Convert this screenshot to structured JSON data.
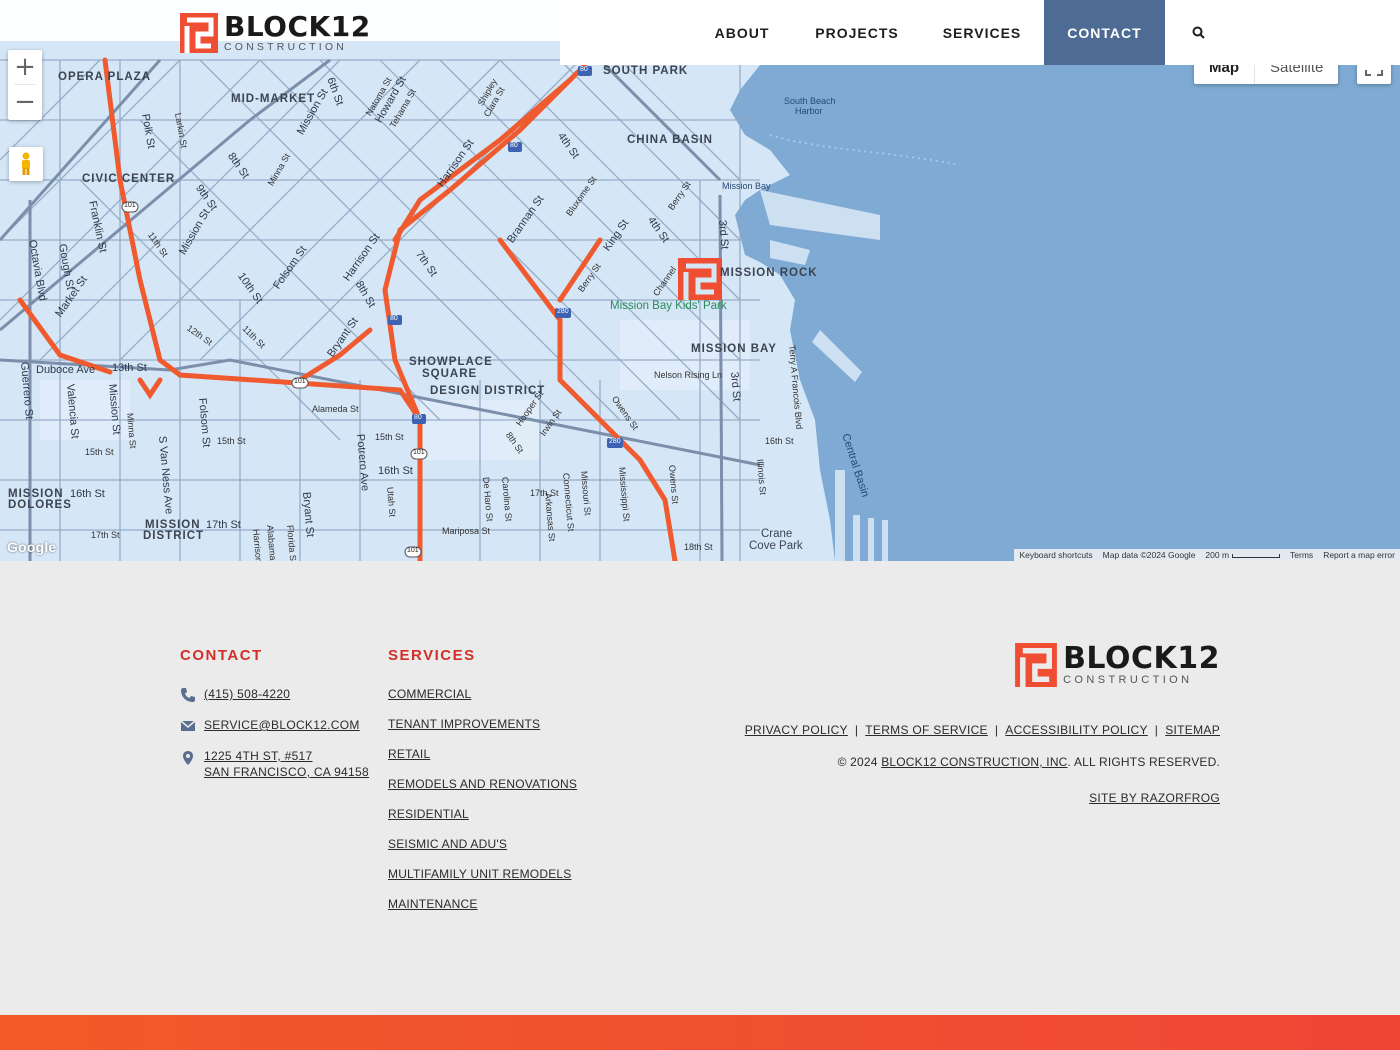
{
  "brand": {
    "name": "BLOCK12",
    "sub": "CONSTRUCTION",
    "accent": "#f04e30",
    "nav_active_bg": "#4e6b93"
  },
  "nav": {
    "about": "ABOUT",
    "projects": "PROJECTS",
    "services": "SERVICES",
    "contact": "CONTACT",
    "search_icon": "search-icon"
  },
  "map": {
    "type_map": "Map",
    "type_satellite": "Satellite",
    "zoom_in": "+",
    "zoom_out": "−",
    "google": "Google",
    "attribution": {
      "shortcuts": "Keyboard shortcuts",
      "data": "Map data ©2024 Google",
      "scale": "200 m",
      "terms": "Terms",
      "report": "Report a map error"
    },
    "districts": [
      "OPERA PLAZA",
      "MID-MARKET",
      "SOUTH PARK",
      "CHINA BASIN",
      "CIVIC CENTER",
      "MISSION ROCK",
      "MISSION BAY",
      "SHOWPLACE",
      "SQUARE",
      "DESIGN DISTRICT",
      "MISSION",
      "DOLORES",
      "MISSION",
      "DISTRICT"
    ],
    "park": "Mission Bay Kids' Park",
    "water": [
      "South Beach",
      "Harbor",
      "Mission Bay",
      "Central Basin",
      "Crane",
      "Cove Park"
    ],
    "streets": [
      "6th St",
      "Mission St",
      "Natoma St",
      "Howard St",
      "Tehama St",
      "Shipley",
      "Clara St",
      "4th St",
      "Polk St",
      "Larkin St",
      "8th St",
      "Minna St",
      "9th St",
      "Franklin St",
      "11th St",
      "Mission St",
      "Harrison St",
      "Brannan St",
      "Bluxome St",
      "Berry St",
      "King St",
      "4th St",
      "3rd St",
      "Channel",
      "Octavia Blvd",
      "Gough St",
      "Market St",
      "10th St",
      "Folsom St",
      "Harrison St",
      "7th St",
      "8th St",
      "Berry St",
      "Duboce Ave",
      "13th St",
      "12th St",
      "11th St",
      "Bryant St",
      "Alameda St",
      "Nelson Rising Ln",
      "Terry A Francois Blvd",
      "Guerrero St",
      "Valencia St",
      "Mission St",
      "Minna St",
      "Folsom St",
      "15th St",
      "15th St",
      "15th St",
      "Potrero Ave",
      "16th St",
      "16th St",
      "Hooper St",
      "Irwin St",
      "8th St",
      "Owens St",
      "3rd St",
      "16th St",
      "Illinois St",
      "17th St",
      "17th St",
      "17th St",
      "S Van Ness Ave",
      "Bryant St",
      "Utah St",
      "De Haro St",
      "Carolina St",
      "Arkansas St",
      "Connecticut St",
      "Missouri St",
      "Mississippi St",
      "Owens St",
      "Mariposa St",
      "18th St",
      "Alabama St",
      "Florida St",
      "Harrison"
    ],
    "shields": [
      "80",
      "80",
      "101",
      "80",
      "280",
      "101",
      "80",
      "101",
      "280",
      "101"
    ]
  },
  "footer": {
    "contact_title": "CONTACT",
    "phone": "(415) 508-4220",
    "email": "SERVICE@BLOCK12.COM",
    "address_line1": "1225 4TH ST, #517",
    "address_line2": "SAN FRANCISCO, CA 94158",
    "services_title": "SERVICES",
    "services": [
      "COMMERCIAL",
      "TENANT IMPROVEMENTS",
      "RETAIL",
      "REMODELS AND RENOVATIONS",
      "RESIDENTIAL",
      "SEISMIC AND ADU'S",
      "MULTIFAMILY UNIT REMODELS",
      "MAINTENANCE"
    ],
    "legal": {
      "privacy": "PRIVACY POLICY",
      "terms": "TERMS OF SERVICE",
      "accessibility": "ACCESSIBILITY POLICY",
      "sitemap": "SITEMAP",
      "separator": "|"
    },
    "copyright_prefix": "© 2024",
    "copyright_company": "BLOCK12 CONSTRUCTION, INC",
    "copyright_suffix": ". ALL RIGHTS RESERVED.",
    "credit": "SITE BY RAZORFROG"
  }
}
